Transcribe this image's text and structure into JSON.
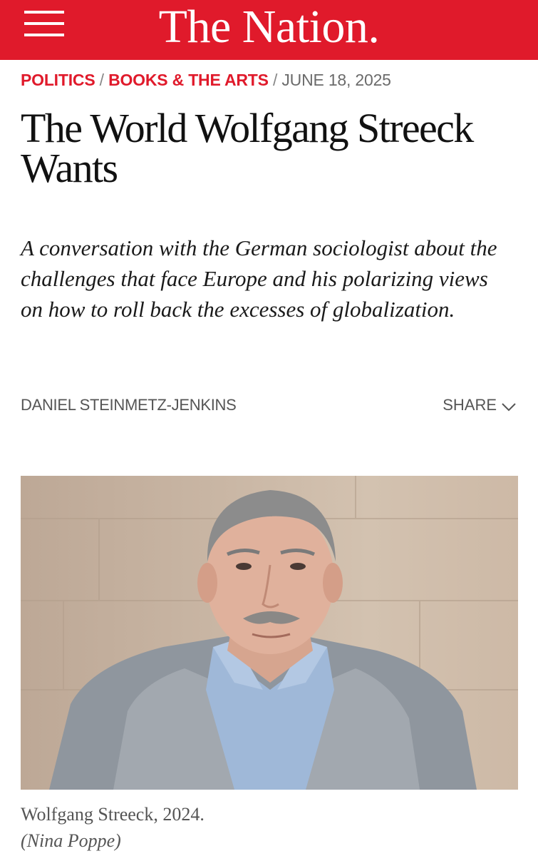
{
  "header": {
    "logo": "The Nation.",
    "menu_icon": "hamburger-menu-icon",
    "brand_color": "#e01a2b"
  },
  "article": {
    "categories": [
      {
        "label": "POLITICS"
      },
      {
        "label": "BOOKS & THE ARTS"
      }
    ],
    "separator": "/",
    "date": "JUNE 18, 2025",
    "headline": "The World Wolfgang Streeck Wants",
    "dek": "A conversation with the German sociologist about the challenges that face Europe and his polarizing views on how to roll back the excesses of globalization.",
    "byline": "DANIEL STEINMETZ-JENKINS",
    "share_label": "SHARE",
    "share_icon": "chevron-down-icon"
  },
  "image": {
    "alt_subject": "Wolfgang Streeck portrait",
    "caption": "Wolfgang Streeck, 2024.",
    "credit": "(Nina Poppe)"
  }
}
